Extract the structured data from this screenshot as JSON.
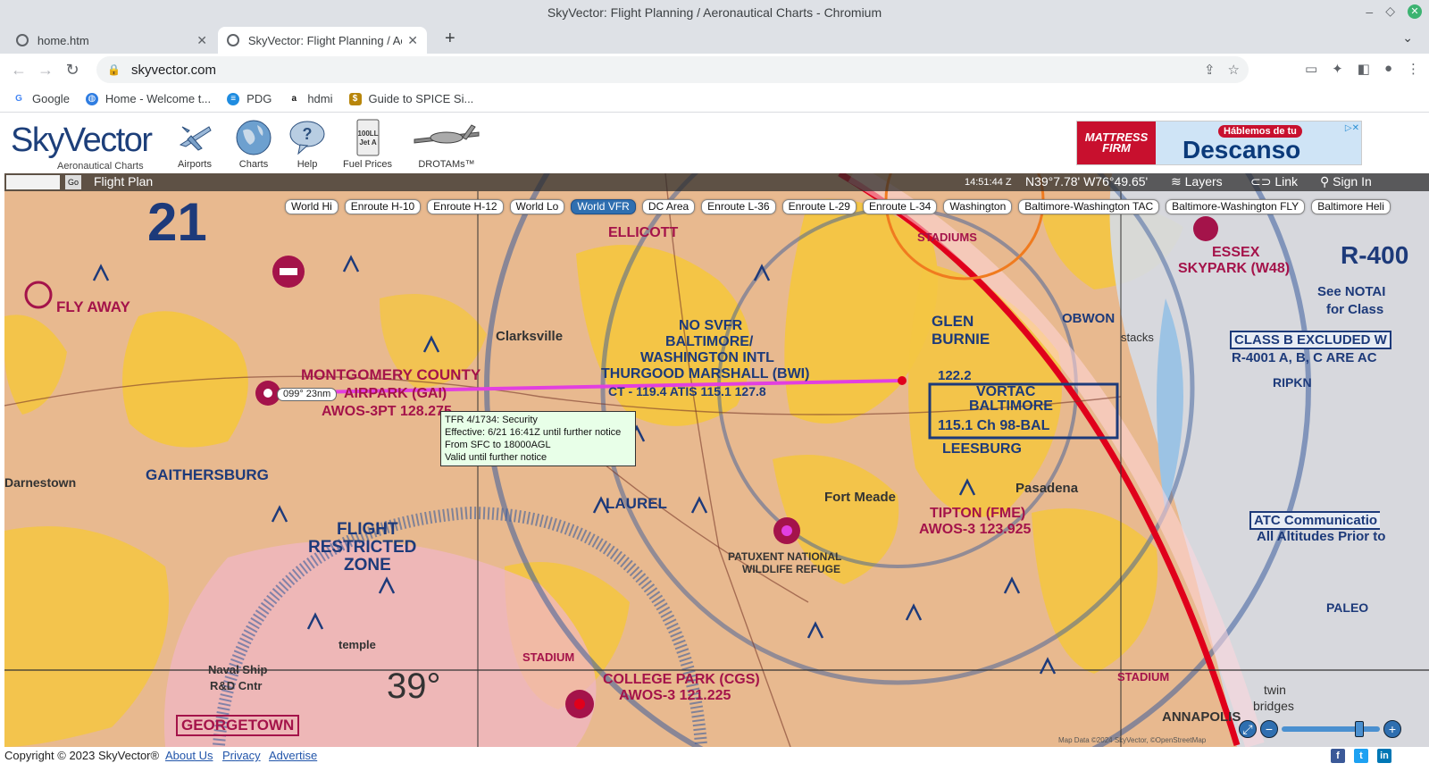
{
  "window": {
    "title": "SkyVector: Flight Planning / Aeronautical Charts - Chromium"
  },
  "tabs": [
    {
      "title": "home.htm"
    },
    {
      "title": "SkyVector: Flight Planning / Aer"
    }
  ],
  "address": {
    "url": "skyvector.com"
  },
  "bookmarks": [
    {
      "label": "Google"
    },
    {
      "label": "Home - Welcome t..."
    },
    {
      "label": "PDG"
    },
    {
      "label": "hdmi"
    },
    {
      "label": "Guide to SPICE Si..."
    }
  ],
  "header": {
    "logo": "SkyVector",
    "logo_sub": "Aeronautical Charts",
    "nav": [
      {
        "label": "Airports",
        "icon": "airplane-icon"
      },
      {
        "label": "Charts",
        "icon": "globe-icon"
      },
      {
        "label": "Help",
        "icon": "speech-bubble-icon"
      },
      {
        "label": "Fuel Prices",
        "icon": "fuel-tag-icon"
      },
      {
        "label": "DROTAMs™",
        "icon": "drone-icon"
      }
    ],
    "ad": {
      "brand": "MATTRESS FIRM",
      "small": "Háblemos de tu",
      "big": "Descanso"
    }
  },
  "map": {
    "topbar": {
      "go": "Go",
      "flight_plan": "Flight Plan",
      "time": "14:51:44 Z",
      "coords": "N39°7.78' W76°49.65'",
      "layers": "Layers",
      "link": "Link",
      "sign_in": "Sign In"
    },
    "chart_tabs": [
      {
        "label": "World Hi",
        "active": false
      },
      {
        "label": "Enroute H-10",
        "active": false
      },
      {
        "label": "Enroute H-12",
        "active": false
      },
      {
        "label": "World Lo",
        "active": false
      },
      {
        "label": "World VFR",
        "active": true
      },
      {
        "label": "DC Area",
        "active": false
      },
      {
        "label": "Enroute L-36",
        "active": false
      },
      {
        "label": "Enroute L-29",
        "active": false
      },
      {
        "label": "Enroute L-34",
        "active": false
      },
      {
        "label": "Washington",
        "active": false
      },
      {
        "label": "Baltimore-Washington TAC",
        "active": false
      },
      {
        "label": "Baltimore-Washington FLY",
        "active": false
      },
      {
        "label": "Baltimore Heli",
        "active": false
      }
    ],
    "route_label": "099° 23nm",
    "tooltip": [
      "TFR 4/1734: Security",
      "Effective: 6/21 16:41Z until further notice",
      "From SFC to 18000AGL",
      "Valid until further notice"
    ],
    "labels": {
      "montgomery": "MONTGOMERY COUNTY",
      "airpark": "AIRPARK (GAI)",
      "awos_gai": "AWOS-3PT 128.275",
      "gaithersburg": "GAITHERSBURG",
      "clarksville": "Clarksville",
      "ellicott": "ELLICOTT",
      "bwi_nosvfr": "NO SVFR",
      "bwi1": "BALTIMORE/",
      "bwi2": "WASHINGTON INTL",
      "bwi3": "THURGOOD MARSHALL (BWI)",
      "bwi_ct": "CT - 119.4  ATIS 115.1 127.8",
      "glen": "GLEN",
      "burnie": "BURNIE",
      "vortac": "VORTAC",
      "baltimore": "BALTIMORE",
      "bal_freq": "115.1 Ch 98-BAL",
      "leesburg": "LEESBURG",
      "freq1222": "122.2",
      "pasadena": "Pasadena",
      "fort_meade": "Fort Meade",
      "tipton": "TIPTON (FME)",
      "awos_fme": "AWOS-3 123.925",
      "laurel": "LAUREL",
      "patuxent": "PATUXENT NATIONAL",
      "wildlife": "WILDLIFE REFUGE",
      "flight": "FLIGHT",
      "restricted": "RESTRICTED",
      "zone": "ZONE",
      "college_park": "COLLEGE PARK (CGS)",
      "awos_cgs": "AWOS-3 121.225",
      "georgetown": "GEORGETOWN",
      "naval1": "Naval Ship",
      "naval2": "R&D Cntr",
      "temple": "temple",
      "annapolis": "ANNAPOLIS",
      "essex": "ESSEX",
      "skypark": "SKYPARK (W48)",
      "fly_away": "FLY AWAY",
      "darnestown": "Darnestown",
      "class_b1": "CLASS B EXCLUDED W",
      "class_b2": "R-4001 A, B, C ARE AC",
      "atc1": "ATC Communicatio",
      "atc2": "All Altitudes Prior to",
      "ripkn": "RIPKN",
      "paleo": "PALEO",
      "twin": "twin",
      "bridges": "bridges",
      "stadium": "STADIUM",
      "stadiums": "STADIUMS",
      "lat39": "39°",
      "r400": "R-400",
      "see_notam": "See NOTAI",
      "for_class": "for Class",
      "obwon": "OBWON",
      "stacks": "stacks"
    },
    "attribution": "Map Data ©2024 SkyVector, ©OpenStreetMap"
  },
  "footer": {
    "copyright": "Copyright © 2023 SkyVector®",
    "links": [
      "About Us",
      "Privacy",
      "Advertise"
    ]
  }
}
